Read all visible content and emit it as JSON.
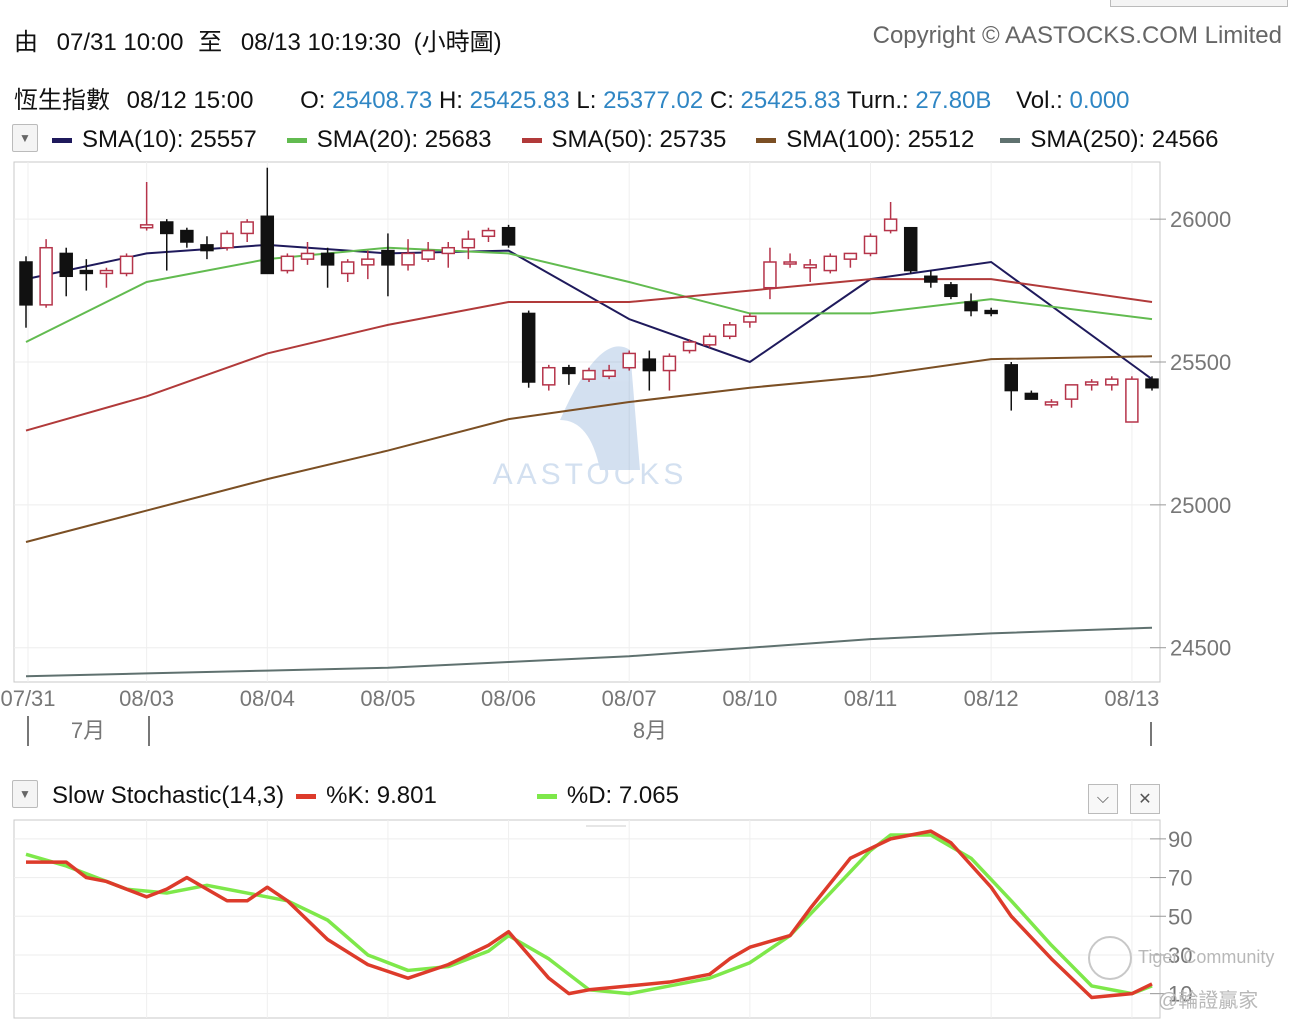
{
  "header": {
    "range_from_label": "由",
    "range_from": "07/31 10:00",
    "range_to_label": "至",
    "range_to": "08/13 10:19:30",
    "chart_interval": "(小時圖)",
    "copyright": "Copyright © AASTOCKS.COM Limited"
  },
  "quote": {
    "name": "恆生指數",
    "datetime": "08/12 15:00",
    "open_label": "O:",
    "open": "25408.73",
    "high_label": "H:",
    "high": "25425.83",
    "low_label": "L:",
    "low": "25377.02",
    "close_label": "C:",
    "close": "25425.83",
    "turnover_label": "Turn.:",
    "turnover": "27.80B",
    "volume_label": "Vol.:",
    "volume": "0.000"
  },
  "sma_legend": [
    {
      "label": "SMA(10): 25557",
      "color": "#1f1a5c"
    },
    {
      "label": "SMA(20): 25683",
      "color": "#62bb50"
    },
    {
      "label": "SMA(50): 25735",
      "color": "#b13a3a"
    },
    {
      "label": "SMA(100): 25512",
      "color": "#7b4f24"
    },
    {
      "label": "SMA(250): 24566",
      "color": "#5f716f"
    }
  ],
  "stoch_legend": {
    "title": "Slow Stochastic(14,3)",
    "k_label": "%K: 9.801",
    "k_color": "#dd3b2b",
    "d_label": "%D: 7.065",
    "d_color": "#7ee84a"
  },
  "watermark": "AASTOCKS",
  "corner_watermark": {
    "line1": "Tiger Community",
    "line2": "@輪證贏家"
  },
  "icons": {
    "dropdown": "triangle-down",
    "collapse": "chevron-down-icon",
    "close": "close-icon"
  },
  "chart_data": [
    {
      "type": "candlestick",
      "ylim": [
        24380,
        26200
      ],
      "y_ticks": [
        24500,
        25000,
        25500,
        26000
      ],
      "x_ticks": [
        "07/31",
        "08/03",
        "08/04",
        "08/05",
        "08/06",
        "08/07",
        "08/10",
        "08/11",
        "08/12",
        "08/13"
      ],
      "x_groups": [
        "7月",
        "8月"
      ],
      "up_color": "#b5344a",
      "down_color": "#111111",
      "grid": true,
      "candles": [
        {
          "o": 25850,
          "h": 25870,
          "l": 25620,
          "c": 25700
        },
        {
          "o": 25700,
          "h": 25930,
          "l": 25690,
          "c": 25900
        },
        {
          "o": 25880,
          "h": 25900,
          "l": 25730,
          "c": 25800
        },
        {
          "o": 25820,
          "h": 25860,
          "l": 25750,
          "c": 25810
        },
        {
          "o": 25810,
          "h": 25830,
          "l": 25760,
          "c": 25820
        },
        {
          "o": 25810,
          "h": 25880,
          "l": 25800,
          "c": 25870
        },
        {
          "o": 25970,
          "h": 26130,
          "l": 25960,
          "c": 25980
        },
        {
          "o": 25990,
          "h": 26000,
          "l": 25820,
          "c": 25950
        },
        {
          "o": 25960,
          "h": 25970,
          "l": 25900,
          "c": 25920
        },
        {
          "o": 25910,
          "h": 25940,
          "l": 25860,
          "c": 25890
        },
        {
          "o": 25900,
          "h": 25960,
          "l": 25890,
          "c": 25950
        },
        {
          "o": 25950,
          "h": 26000,
          "l": 25920,
          "c": 25990
        },
        {
          "o": 26010,
          "h": 26180,
          "l": 25810,
          "c": 25810
        },
        {
          "o": 25820,
          "h": 25880,
          "l": 25810,
          "c": 25870
        },
        {
          "o": 25860,
          "h": 25920,
          "l": 25840,
          "c": 25880
        },
        {
          "o": 25880,
          "h": 25900,
          "l": 25760,
          "c": 25840
        },
        {
          "o": 25810,
          "h": 25860,
          "l": 25780,
          "c": 25850
        },
        {
          "o": 25840,
          "h": 25890,
          "l": 25790,
          "c": 25860
        },
        {
          "o": 25890,
          "h": 25950,
          "l": 25730,
          "c": 25840
        },
        {
          "o": 25840,
          "h": 25930,
          "l": 25820,
          "c": 25880
        },
        {
          "o": 25860,
          "h": 25920,
          "l": 25850,
          "c": 25890
        },
        {
          "o": 25880,
          "h": 25920,
          "l": 25830,
          "c": 25900
        },
        {
          "o": 25900,
          "h": 25960,
          "l": 25860,
          "c": 25930
        },
        {
          "o": 25940,
          "h": 25970,
          "l": 25920,
          "c": 25960
        },
        {
          "o": 25970,
          "h": 25980,
          "l": 25900,
          "c": 25910
        },
        {
          "o": 25670,
          "h": 25680,
          "l": 25410,
          "c": 25430
        },
        {
          "o": 25420,
          "h": 25490,
          "l": 25400,
          "c": 25480
        },
        {
          "o": 25480,
          "h": 25490,
          "l": 25420,
          "c": 25460
        },
        {
          "o": 25440,
          "h": 25480,
          "l": 25430,
          "c": 25470
        },
        {
          "o": 25450,
          "h": 25490,
          "l": 25440,
          "c": 25470
        },
        {
          "o": 25480,
          "h": 25540,
          "l": 25470,
          "c": 25530
        },
        {
          "o": 25510,
          "h": 25540,
          "l": 25400,
          "c": 25470
        },
        {
          "o": 25470,
          "h": 25530,
          "l": 25400,
          "c": 25520
        },
        {
          "o": 25540,
          "h": 25580,
          "l": 25530,
          "c": 25570
        },
        {
          "o": 25560,
          "h": 25600,
          "l": 25550,
          "c": 25590
        },
        {
          "o": 25590,
          "h": 25640,
          "l": 25580,
          "c": 25630
        },
        {
          "o": 25640,
          "h": 25670,
          "l": 25620,
          "c": 25660
        },
        {
          "o": 25760,
          "h": 25900,
          "l": 25720,
          "c": 25850
        },
        {
          "o": 25850,
          "h": 25880,
          "l": 25830,
          "c": 25850
        },
        {
          "o": 25830,
          "h": 25860,
          "l": 25780,
          "c": 25840
        },
        {
          "o": 25820,
          "h": 25880,
          "l": 25810,
          "c": 25870
        },
        {
          "o": 25860,
          "h": 25880,
          "l": 25830,
          "c": 25880
        },
        {
          "o": 25880,
          "h": 25950,
          "l": 25870,
          "c": 25940
        },
        {
          "o": 25960,
          "h": 26060,
          "l": 25950,
          "c": 26000
        },
        {
          "o": 25970,
          "h": 25970,
          "l": 25810,
          "c": 25820
        },
        {
          "o": 25800,
          "h": 25820,
          "l": 25760,
          "c": 25780
        },
        {
          "o": 25770,
          "h": 25780,
          "l": 25720,
          "c": 25730
        },
        {
          "o": 25710,
          "h": 25740,
          "l": 25660,
          "c": 25680
        },
        {
          "o": 25680,
          "h": 25690,
          "l": 25660,
          "c": 25670
        },
        {
          "o": 25490,
          "h": 25500,
          "l": 25330,
          "c": 25400
        },
        {
          "o": 25390,
          "h": 25400,
          "l": 25370,
          "c": 25370
        },
        {
          "o": 25350,
          "h": 25370,
          "l": 25340,
          "c": 25360
        },
        {
          "o": 25370,
          "h": 25420,
          "l": 25340,
          "c": 25420
        },
        {
          "o": 25420,
          "h": 25440,
          "l": 25400,
          "c": 25430
        },
        {
          "o": 25420,
          "h": 25450,
          "l": 25400,
          "c": 25440
        },
        {
          "o": 25290,
          "h": 25450,
          "l": 25290,
          "c": 25440
        },
        {
          "o": 25440,
          "h": 25450,
          "l": 25400,
          "c": 25410
        }
      ],
      "series": [
        {
          "name": "SMA(10)",
          "color": "#1f1a5c",
          "x": [
            0,
            6,
            12,
            18,
            24,
            30,
            36,
            42,
            48,
            56
          ],
          "values": [
            25790,
            25880,
            25910,
            25880,
            25890,
            25650,
            25500,
            25790,
            25850,
            25440
          ]
        },
        {
          "name": "SMA(20)",
          "color": "#62bb50",
          "x": [
            0,
            6,
            12,
            18,
            24,
            30,
            36,
            42,
            48,
            56
          ],
          "values": [
            25570,
            25780,
            25860,
            25900,
            25880,
            25780,
            25670,
            25670,
            25720,
            25650
          ]
        },
        {
          "name": "SMA(50)",
          "color": "#b13a3a",
          "x": [
            0,
            6,
            12,
            18,
            24,
            30,
            36,
            42,
            48,
            56
          ],
          "values": [
            25260,
            25380,
            25530,
            25630,
            25710,
            25710,
            25750,
            25790,
            25790,
            25710
          ]
        },
        {
          "name": "SMA(100)",
          "color": "#7b4f24",
          "x": [
            0,
            6,
            12,
            18,
            24,
            30,
            36,
            42,
            48,
            56
          ],
          "values": [
            24870,
            24980,
            25090,
            25190,
            25300,
            25360,
            25410,
            25450,
            25510,
            25520
          ]
        },
        {
          "name": "SMA(250)",
          "color": "#5f716f",
          "x": [
            0,
            6,
            12,
            18,
            24,
            30,
            36,
            42,
            48,
            56
          ],
          "values": [
            24400,
            24410,
            24420,
            24430,
            24450,
            24470,
            24500,
            24530,
            24550,
            24570
          ]
        }
      ]
    },
    {
      "type": "line",
      "ylim": [
        0,
        100
      ],
      "y_ticks": [
        10,
        30,
        50,
        70,
        90
      ],
      "series": [
        {
          "name": "%K",
          "color": "#dd3b2b",
          "x": [
            0,
            2,
            3,
            4,
            6,
            7,
            8,
            10,
            11,
            12,
            13,
            15,
            17,
            19,
            21,
            23,
            24,
            26,
            27,
            28,
            30,
            32,
            34,
            35,
            36,
            38,
            39,
            41,
            43,
            45,
            46,
            48,
            49,
            51,
            53,
            55,
            56
          ],
          "values": [
            78,
            78,
            70,
            68,
            60,
            64,
            70,
            58,
            58,
            65,
            58,
            38,
            25,
            18,
            25,
            35,
            42,
            18,
            10,
            12,
            14,
            16,
            20,
            28,
            34,
            40,
            54,
            80,
            90,
            94,
            88,
            65,
            50,
            28,
            8,
            10,
            15
          ]
        },
        {
          "name": "%D",
          "color": "#7ee84a",
          "x": [
            0,
            2,
            4,
            5,
            7,
            9,
            11,
            13,
            15,
            17,
            19,
            21,
            23,
            24,
            26,
            28,
            30,
            32,
            34,
            36,
            38,
            40,
            42,
            43,
            45,
            47,
            49,
            51,
            53,
            55,
            56
          ],
          "values": [
            82,
            76,
            68,
            64,
            62,
            66,
            62,
            58,
            48,
            30,
            22,
            24,
            32,
            40,
            28,
            12,
            10,
            14,
            18,
            26,
            40,
            62,
            84,
            92,
            92,
            80,
            58,
            35,
            14,
            10,
            14
          ]
        }
      ]
    }
  ]
}
